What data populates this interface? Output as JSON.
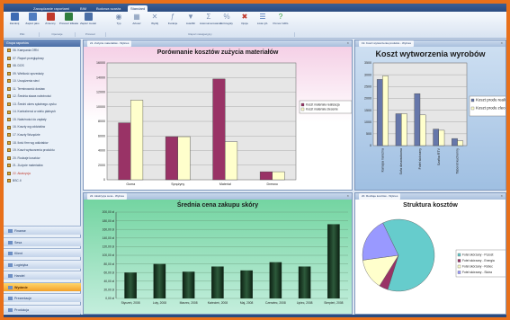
{
  "ribbon": {
    "tabs": [
      "Zarządzanie raportami",
      "BIM",
      "Budowa szarża",
      "Standard"
    ],
    "groups": [
      "Pliki",
      "Operacje",
      "Przesuń",
      "Raport nawigacyjny"
    ],
    "buttons": [
      "Zamknij",
      "Zapisz jako",
      "Zmienny",
      "Przesuń kilkaka",
      "Zapisz model",
      "Typ",
      "Arkusz",
      "Wyślij",
      "Funkcje",
      "Autofiltr",
      "Autonumerowanie",
      "Szczegóły",
      "Opcje",
      "Lista ryb.",
      "Pomoc GDG"
    ],
    "active_tab": "Standard"
  },
  "sidebar": {
    "header": "Grupa raportów",
    "items": [
      "06. Kampania ORN",
      "07. Raport przeglądowy",
      "08. DOS",
      "09. Wielkość sprzedaży",
      "10. Urządzenia sieci",
      "11. Terminowość dostaw",
      "12. Średnia stawa należności",
      "13. Średni okres spłatnego zysku",
      "14. Kontrahenci w wielu płatnych",
      "15. Należności do zapłaty",
      "16. Koszty wg oddziałów",
      "17. Koszty Wszędzie",
      "18. Ilość firm wg oddziałów",
      "19. Koszt wytworzenia produktu",
      "20. Rodzaje kosztów",
      "21. Zużycie materiałów",
      "22. Akwizycja",
      "BSC.II"
    ],
    "highlighted": "22. Akwizycja",
    "nav": [
      "Finanse",
      "Sesa",
      "Klient",
      "Logistyka",
      "Handel",
      "Wydanie",
      "Prezentacje",
      "Produkcja"
    ],
    "active_nav": "Wydanie"
  },
  "panels": {
    "p1_tab": "21. Zużycie materiałów - Wykres",
    "p2_tab": "19. Koszt wytworzenia produktu - Wykres",
    "p3_tab": "22. Akwizycja cena - Wykres",
    "p4_tab": "20. Rodzaje kosztów - Wykres"
  },
  "chart_data": [
    {
      "type": "bar",
      "title": "Porównanie kosztów zużycia materiałów",
      "categories": [
        "Guma",
        "Sprężyny",
        "Materiał",
        "Drewno"
      ],
      "series": [
        {
          "name": "Koszt materiału realizacja",
          "values": [
            7800,
            5900,
            13800,
            1100
          ],
          "color": "#993366"
        },
        {
          "name": "Koszt materiału zlecenie",
          "values": [
            10900,
            5900,
            5200,
            1100
          ],
          "color": "#ffffcc"
        }
      ],
      "yticks": [
        "0",
        "2000",
        "4000",
        "6000",
        "8000",
        "10000",
        "12000",
        "14000",
        "16000"
      ],
      "ylim": [
        0,
        16000
      ]
    },
    {
      "type": "bar",
      "title": "Koszt wytworzenia wyrobów",
      "categories": [
        "Kanapa narożna",
        "Sofa dwuosobowa",
        "Fotel skórzany",
        "Szafka RTV",
        "Taboret kuchenny"
      ],
      "series": [
        {
          "name": "Koszt produ realizacja",
          "values": [
            2800,
            1350,
            2200,
            700,
            300
          ],
          "color": "#6677aa"
        },
        {
          "name": "Koszt produ zlecenie",
          "values": [
            2950,
            1350,
            1300,
            650,
            200
          ],
          "color": "#ffffcc"
        }
      ],
      "yticks": [
        "0",
        "500",
        "1000",
        "1500",
        "2000",
        "2500",
        "3000",
        "3500"
      ],
      "ylim": [
        0,
        3500
      ]
    },
    {
      "type": "bar",
      "title": "Średnia cena zakupu skóry",
      "categories": [
        "Styczeń, 2008",
        "Luty, 2008",
        "Marzec, 2008",
        "Kwiecień, 2008",
        "Maj, 2008",
        "Czerwiec, 2008",
        "Lipiec, 2008",
        "Sierpień, 2008"
      ],
      "values": [
        60,
        80,
        62,
        74,
        65,
        84,
        74,
        172
      ],
      "yticks": [
        "0,00 zł",
        "20,00 zł",
        "40,00 zł",
        "60,00 zł",
        "80,00 zł",
        "100,00 zł",
        "120,00 zł",
        "140,00 zł",
        "160,00 zł",
        "180,00 zł",
        "200,00 zł"
      ],
      "ylim": [
        0,
        200
      ]
    },
    {
      "type": "pie",
      "title": "Struktura kosztów",
      "slices": [
        {
          "name": "Fotel skórzany - Pozost",
          "value": 62,
          "color": "#66cccc"
        },
        {
          "name": "Fotel skórzany - Energia",
          "value": 4,
          "color": "#993366"
        },
        {
          "name": "Fotel skórzany - Roboc",
          "value": 14,
          "color": "#ffffcc"
        },
        {
          "name": "Fotel skórzany - Skóra",
          "value": 20,
          "color": "#9999ff"
        }
      ]
    }
  ]
}
